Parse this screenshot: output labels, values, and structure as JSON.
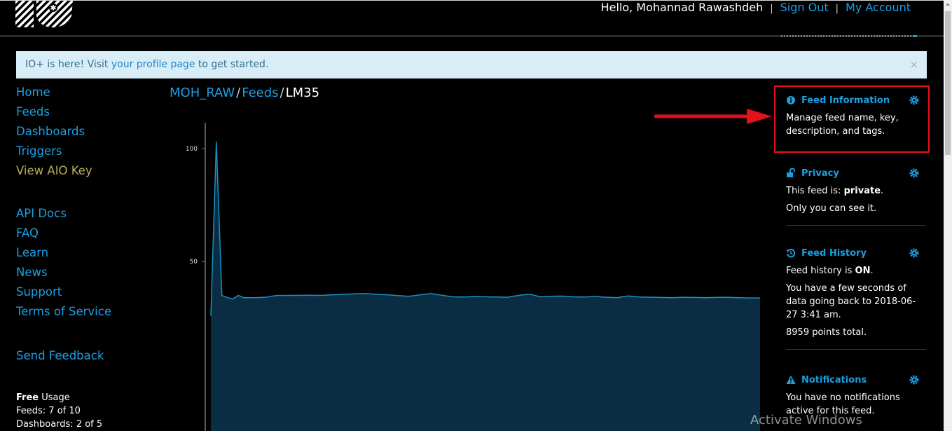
{
  "header": {
    "greeting": "Hello, Mohannad Rawashdeh",
    "separator": "|",
    "sign_out": "Sign Out",
    "my_account": "My Account"
  },
  "alert": {
    "prefix": "IO+ is here! Visit ",
    "link": "your profile page",
    "suffix": " to get started.",
    "close": "×"
  },
  "sidebar": {
    "main": [
      "Home",
      "Feeds",
      "Dashboards",
      "Triggers"
    ],
    "key": "View AIO Key",
    "resources": [
      "API Docs",
      "FAQ",
      "Learn",
      "News",
      "Support",
      "Terms of Service"
    ],
    "feedback": "Send Feedback",
    "usage": {
      "plan": "Free",
      "plan_suffix": " Usage",
      "feeds": "Feeds: 7 of 10",
      "dashboards": "Dashboards: 2 of 5"
    }
  },
  "breadcrumb": {
    "user": "MOH_RAW",
    "slash": "/",
    "feeds": "Feeds",
    "current": "LM35"
  },
  "chart_data": {
    "type": "area",
    "title": "",
    "xlabel": "",
    "ylabel": "",
    "yticks": [
      50,
      100
    ],
    "ylim": [
      -25,
      113
    ],
    "x": [
      0,
      1,
      2,
      3,
      4,
      5,
      6,
      8,
      10,
      12,
      15,
      18,
      20,
      24,
      28,
      32,
      36,
      40,
      44,
      46,
      48,
      50,
      52,
      54,
      56,
      58,
      60,
      62,
      64,
      66,
      68,
      70,
      72,
      74,
      76,
      78,
      80,
      82,
      84,
      86,
      88,
      90,
      92,
      94,
      96,
      98,
      100
    ],
    "values": [
      26,
      103,
      35,
      34,
      33.5,
      35,
      34,
      34,
      34.2,
      35,
      35,
      35.1,
      35,
      35.5,
      35.8,
      35.3,
      34.6,
      35.8,
      34.4,
      34.3,
      34.5,
      34.4,
      34.3,
      34.2,
      35,
      35.6,
      34.4,
      34.6,
      34.7,
      34.4,
      34.3,
      34.5,
      34.2,
      34,
      34.8,
      34.3,
      34.2,
      34.1,
      34,
      34.2,
      34.1,
      34,
      34.1,
      34.2,
      34,
      33.9,
      33.9
    ]
  },
  "panel": {
    "info": {
      "title": "Feed Information",
      "body": "Manage feed name, key, description, and tags."
    },
    "privacy": {
      "title": "Privacy",
      "line1_prefix": "This feed is: ",
      "line1_value": "private",
      "line1_suffix": ".",
      "line2": "Only you can see it."
    },
    "history": {
      "title": "Feed History",
      "line1_prefix": "Feed history is ",
      "line1_value": "ON",
      "line1_suffix": ".",
      "line2": "You have a few seconds of data going back to 2018-06-27 3:41 am.",
      "line3": "8959 points total."
    },
    "notify": {
      "title": "Notifications",
      "body": "You have no notifications active for this feed."
    }
  },
  "watermark": "Activate Windows",
  "colors": {
    "accent": "#1b9fe0",
    "chart_line": "#1a90c0",
    "chart_fill": "#0b2d43",
    "highlight": "#e5101a",
    "alert_bg": "#d9edf7"
  }
}
